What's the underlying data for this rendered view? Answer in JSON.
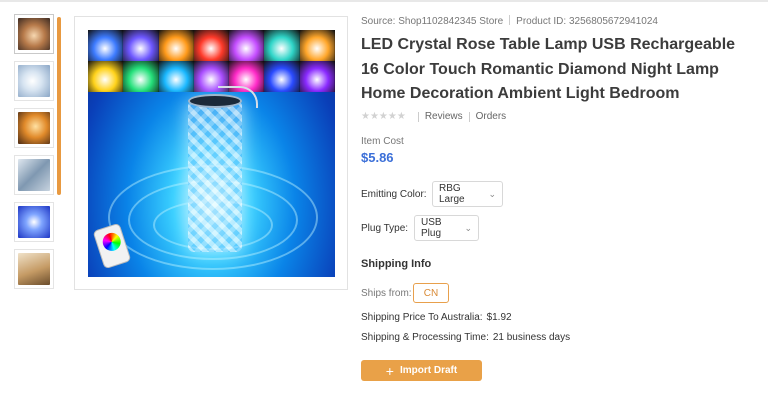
{
  "colors": {
    "accent": "#e9a148",
    "price": "#3b6fd8",
    "origin_border": "#e8a04c",
    "swatches_row1": [
      "#3d7bff",
      "#6d57ff",
      "#ff9a1a",
      "#ff3a2a",
      "#c44dff",
      "#2fd5c8",
      "#ffa62a"
    ],
    "swatches_row2": [
      "#ffd21a",
      "#24e07a",
      "#1ab8ff",
      "#a94dff",
      "#ff2ac8",
      "#2a4bff",
      "#8a2aff"
    ]
  },
  "product": {
    "source": "Source: Shop1102842345 Store",
    "product_id": "Product ID: 3256805672941024",
    "title": "LED Crystal Rose Table Lamp USB Rechargeable 16 Color Touch Romantic Diamond Night Lamp Home Decoration Ambient Light Bedroom",
    "rating": {
      "stars": "★★★★★",
      "reviews_label": "Reviews",
      "orders_label": "Orders"
    },
    "item_cost_label": "Item Cost",
    "price": "$5.86"
  },
  "options": {
    "emitting_color": {
      "label": "Emitting Color:",
      "value": "RBG Large"
    },
    "plug_type": {
      "label": "Plug Type:",
      "value": "USB Plug"
    }
  },
  "shipping": {
    "title": "Shipping Info",
    "ships_from_label": "Ships from:",
    "ships_from_value": "CN",
    "price_label": "Shipping Price To Australia:",
    "price_value": "$1.92",
    "time_label": "Shipping & Processing Time:",
    "time_value": "21 business days"
  },
  "actions": {
    "import_label": "Import Draft",
    "import_icon": "plus-icon"
  },
  "gallery": {
    "thumbnail_count": 6,
    "active_index": 0
  }
}
